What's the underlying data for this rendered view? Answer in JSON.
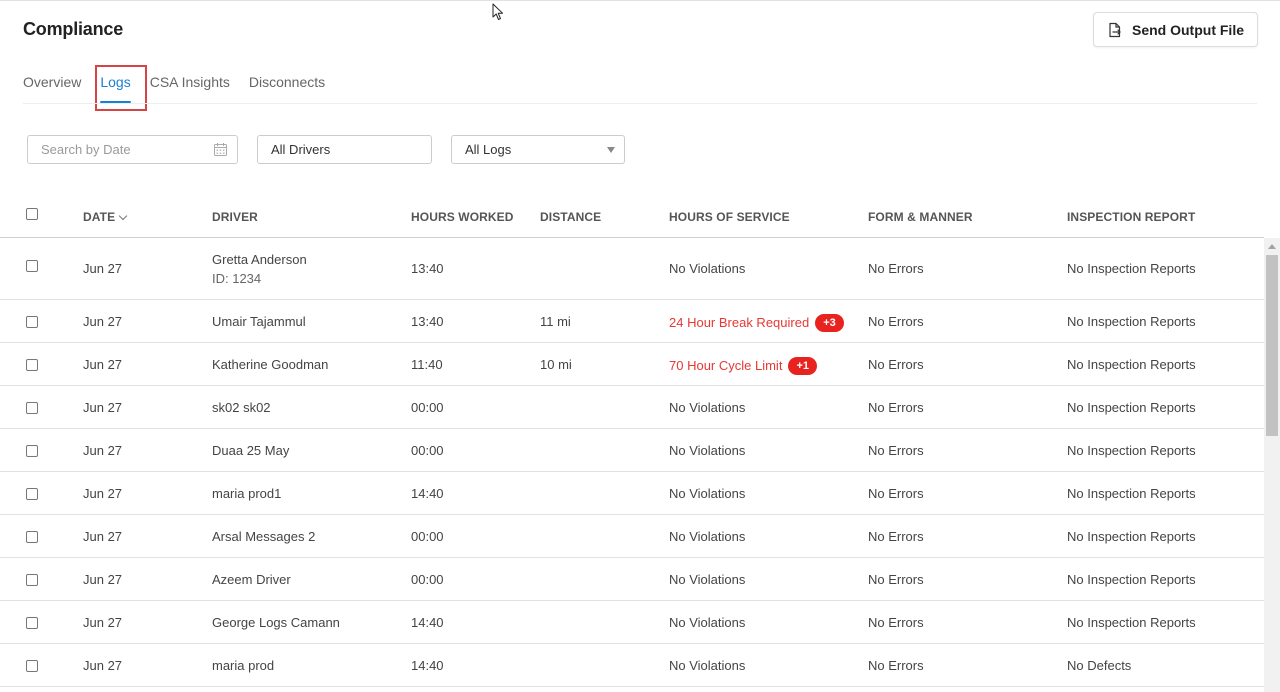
{
  "page": {
    "title": "Compliance"
  },
  "header": {
    "send_button_label": "Send Output File"
  },
  "tabs": [
    {
      "label": "Overview",
      "active": false
    },
    {
      "label": "Logs",
      "active": true
    },
    {
      "label": "CSA Insights",
      "active": false
    },
    {
      "label": "Disconnects",
      "active": false
    }
  ],
  "filters": {
    "search_placeholder": "Search by Date",
    "drivers_value": "All Drivers",
    "logs_value": "All Logs"
  },
  "table": {
    "columns": [
      "DATE",
      "DRIVER",
      "HOURS WORKED",
      "DISTANCE",
      "HOURS OF SERVICE",
      "FORM & MANNER",
      "INSPECTION REPORT"
    ],
    "rows": [
      {
        "date": "Jun 27",
        "driver": "Gretta Anderson",
        "driver_id": "ID: 1234",
        "hours": "13:40",
        "distance": "",
        "hos": "No Violations",
        "hos_badge": "",
        "form": "No Errors",
        "inspection": "No Inspection Reports"
      },
      {
        "date": "Jun 27",
        "driver": "Umair Tajammul",
        "driver_id": "",
        "hours": "13:40",
        "distance": "11 mi",
        "hos": "24 Hour Break Required",
        "hos_badge": "+3",
        "form": "No Errors",
        "inspection": "No Inspection Reports"
      },
      {
        "date": "Jun 27",
        "driver": "Katherine Goodman",
        "driver_id": "",
        "hours": "11:40",
        "distance": "10 mi",
        "hos": "70 Hour Cycle Limit",
        "hos_badge": "+1",
        "form": "No Errors",
        "inspection": "No Inspection Reports"
      },
      {
        "date": "Jun 27",
        "driver": "sk02 sk02",
        "driver_id": "",
        "hours": "00:00",
        "distance": "",
        "hos": "No Violations",
        "hos_badge": "",
        "form": "No Errors",
        "inspection": "No Inspection Reports"
      },
      {
        "date": "Jun 27",
        "driver": "Duaa 25 May",
        "driver_id": "",
        "hours": "00:00",
        "distance": "",
        "hos": "No Violations",
        "hos_badge": "",
        "form": "No Errors",
        "inspection": "No Inspection Reports"
      },
      {
        "date": "Jun 27",
        "driver": "maria prod1",
        "driver_id": "",
        "hours": "14:40",
        "distance": "",
        "hos": "No Violations",
        "hos_badge": "",
        "form": "No Errors",
        "inspection": "No Inspection Reports"
      },
      {
        "date": "Jun 27",
        "driver": "Arsal Messages 2",
        "driver_id": "",
        "hours": "00:00",
        "distance": "",
        "hos": "No Violations",
        "hos_badge": "",
        "form": "No Errors",
        "inspection": "No Inspection Reports"
      },
      {
        "date": "Jun 27",
        "driver": "Azeem Driver",
        "driver_id": "",
        "hours": "00:00",
        "distance": "",
        "hos": "No Violations",
        "hos_badge": "",
        "form": "No Errors",
        "inspection": "No Inspection Reports"
      },
      {
        "date": "Jun 27",
        "driver": "George Logs Camann",
        "driver_id": "",
        "hours": "14:40",
        "distance": "",
        "hos": "No Violations",
        "hos_badge": "",
        "form": "No Errors",
        "inspection": "No Inspection Reports"
      },
      {
        "date": "Jun 27",
        "driver": "maria prod",
        "driver_id": "",
        "hours": "14:40",
        "distance": "",
        "hos": "No Violations",
        "hos_badge": "",
        "form": "No Errors",
        "inspection": "No Defects"
      }
    ]
  },
  "colors": {
    "accent": "#1a7fd6",
    "violation": "#e53935",
    "badge": "#e8231f",
    "highlight": "#d64545"
  },
  "icons": {
    "send": "file-export-icon",
    "calendar": "calendar-icon",
    "dropdown": "caret-down-icon",
    "sort": "chevron-down-icon"
  }
}
